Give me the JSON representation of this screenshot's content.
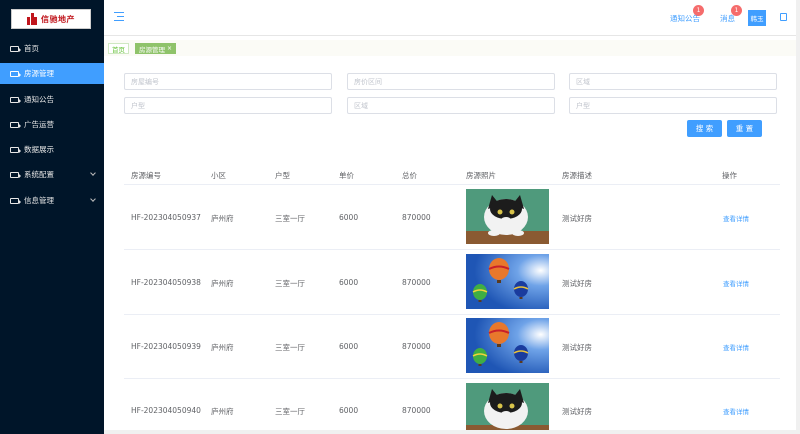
{
  "brand": {
    "logo_text": "信驰地产"
  },
  "sidebar": {
    "items": [
      {
        "label": "首页"
      },
      {
        "label": "房源管理"
      },
      {
        "label": "通知公告"
      },
      {
        "label": "广告运营"
      },
      {
        "label": "数据展示"
      },
      {
        "label": "系统配置"
      },
      {
        "label": "信息管理"
      }
    ]
  },
  "header": {
    "notice_label": "通知公告",
    "notice_badge": "1",
    "message_label": "消息",
    "message_badge": "1",
    "user_label": "韩玉"
  },
  "tags": {
    "home": "首页",
    "current": "房源管理",
    "close": "×"
  },
  "search": {
    "placeholders": [
      "房屋编号",
      "房价区间",
      "区域",
      "户型",
      "区域",
      "户型"
    ],
    "search_button": "搜 索",
    "reset_button": "重 置"
  },
  "table": {
    "headers": [
      "房源编号",
      "小区",
      "户型",
      "单价",
      "总价",
      "房源照片",
      "房源描述",
      "操作"
    ],
    "rows": [
      {
        "id": "HF-202304050937",
        "community": "庐州府",
        "layout": "三室一厅",
        "unit_price": "6000",
        "total_price": "870000",
        "photo": "cat-photo",
        "desc": "测试好房",
        "action": "查看详情"
      },
      {
        "id": "HF-202304050938",
        "community": "庐州府",
        "layout": "三室一厅",
        "unit_price": "6000",
        "total_price": "870000",
        "photo": "balloons-photo",
        "desc": "测试好房",
        "action": "查看详情"
      },
      {
        "id": "HF-202304050939",
        "community": "庐州府",
        "layout": "三室一厅",
        "unit_price": "6000",
        "total_price": "870000",
        "photo": "balloons-photo",
        "desc": "测试好房",
        "action": "查看详情"
      },
      {
        "id": "HF-202304050940",
        "community": "庐州府",
        "layout": "三室一厅",
        "unit_price": "6000",
        "total_price": "870000",
        "photo": "cat-photo",
        "desc": "测试好房",
        "action": "查看详情"
      }
    ]
  },
  "colors": {
    "sidebar_bg": "#001529",
    "primary": "#409eff",
    "badge": "#f56c6c",
    "tag_green": "#8fc36a"
  }
}
